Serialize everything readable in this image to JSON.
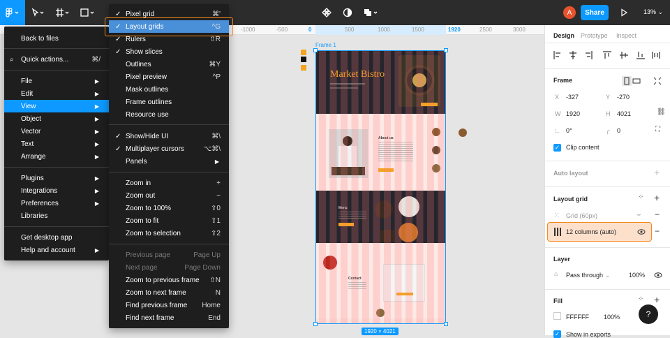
{
  "toolbar": {
    "share": "Share",
    "zoom": "13%",
    "avatar": "A"
  },
  "ruler": {
    "ticks": [
      "-1000",
      "-500",
      "0",
      "500",
      "1000",
      "1500",
      "1920",
      "2500",
      "3000"
    ]
  },
  "frame": {
    "label": "Frame 1",
    "size": "1920 × 4021"
  },
  "design": {
    "hero_title": "Market Bistro",
    "about": "About us",
    "menu": "Menu",
    "contact": "Contact"
  },
  "main_menu": {
    "items": [
      {
        "label": "Back to files",
        "shortcut": "",
        "arrow": false
      },
      {
        "label": "Quick actions...",
        "shortcut": "⌘/",
        "arrow": false
      },
      {
        "label": "File",
        "arrow": true
      },
      {
        "label": "Edit",
        "arrow": true
      },
      {
        "label": "View",
        "arrow": true
      },
      {
        "label": "Object",
        "arrow": true
      },
      {
        "label": "Vector",
        "arrow": true
      },
      {
        "label": "Text",
        "arrow": true
      },
      {
        "label": "Arrange",
        "arrow": true
      },
      {
        "label": "Plugins",
        "arrow": true
      },
      {
        "label": "Integrations",
        "arrow": true
      },
      {
        "label": "Preferences",
        "arrow": true
      },
      {
        "label": "Libraries",
        "arrow": false
      },
      {
        "label": "Get desktop app",
        "arrow": false
      },
      {
        "label": "Help and account",
        "arrow": true
      }
    ]
  },
  "view_menu": {
    "items": [
      {
        "label": "Pixel grid",
        "shortcut": "⌘'",
        "checked": true
      },
      {
        "label": "Layout grids",
        "shortcut": "^G",
        "checked": true
      },
      {
        "label": "Rulers",
        "shortcut": "⇧R",
        "checked": true
      },
      {
        "label": "Show slices",
        "shortcut": "",
        "checked": true
      },
      {
        "label": "Outlines",
        "shortcut": "⌘Y",
        "checked": false
      },
      {
        "label": "Pixel preview",
        "shortcut": "^P",
        "checked": false
      },
      {
        "label": "Mask outlines",
        "shortcut": "",
        "checked": false
      },
      {
        "label": "Frame outlines",
        "shortcut": "",
        "checked": false
      },
      {
        "label": "Resource use",
        "shortcut": "",
        "checked": false
      },
      {
        "label": "Show/Hide UI",
        "shortcut": "⌘\\",
        "checked": true
      },
      {
        "label": "Multiplayer cursors",
        "shortcut": "⌥⌘\\",
        "checked": true
      },
      {
        "label": "Panels",
        "shortcut": "",
        "checked": false
      },
      {
        "label": "Zoom in",
        "shortcut": "+",
        "checked": false
      },
      {
        "label": "Zoom out",
        "shortcut": "−",
        "checked": false
      },
      {
        "label": "Zoom to 100%",
        "shortcut": "⇧0",
        "checked": false
      },
      {
        "label": "Zoom to fit",
        "shortcut": "⇧1",
        "checked": false
      },
      {
        "label": "Zoom to selection",
        "shortcut": "⇧2",
        "checked": false
      },
      {
        "label": "Previous page",
        "shortcut": "Page Up",
        "checked": false
      },
      {
        "label": "Next page",
        "shortcut": "Page Down",
        "checked": false
      },
      {
        "label": "Zoom to previous frame",
        "shortcut": "⇧N",
        "checked": false
      },
      {
        "label": "Zoom to next frame",
        "shortcut": "N",
        "checked": false
      },
      {
        "label": "Find previous frame",
        "shortcut": "Home",
        "checked": false
      },
      {
        "label": "Find next frame",
        "shortcut": "End",
        "checked": false
      }
    ]
  },
  "panel": {
    "tabs": [
      "Design",
      "Prototype",
      "Inspect"
    ],
    "frame_title": "Frame",
    "x_label": "X",
    "x": "-327",
    "y_label": "Y",
    "y": "-270",
    "w_label": "W",
    "w": "1920",
    "h_label": "H",
    "h": "4021",
    "rotation": "0°",
    "radius": "0",
    "clip": "Clip content",
    "auto_layout": "Auto layout",
    "layout_grid": "Layout grid",
    "grid1": "Grid (60px)",
    "grid2": "12 columns (auto)",
    "layer": "Layer",
    "blend": "Pass through",
    "opacity": "100%",
    "fill": "Fill",
    "fill_hex": "FFFFFF",
    "fill_opacity": "100%",
    "show_exports": "Show in exports",
    "help": "?"
  },
  "colors": {
    "accent": "#0d99ff",
    "highlight": "#f4891f"
  }
}
